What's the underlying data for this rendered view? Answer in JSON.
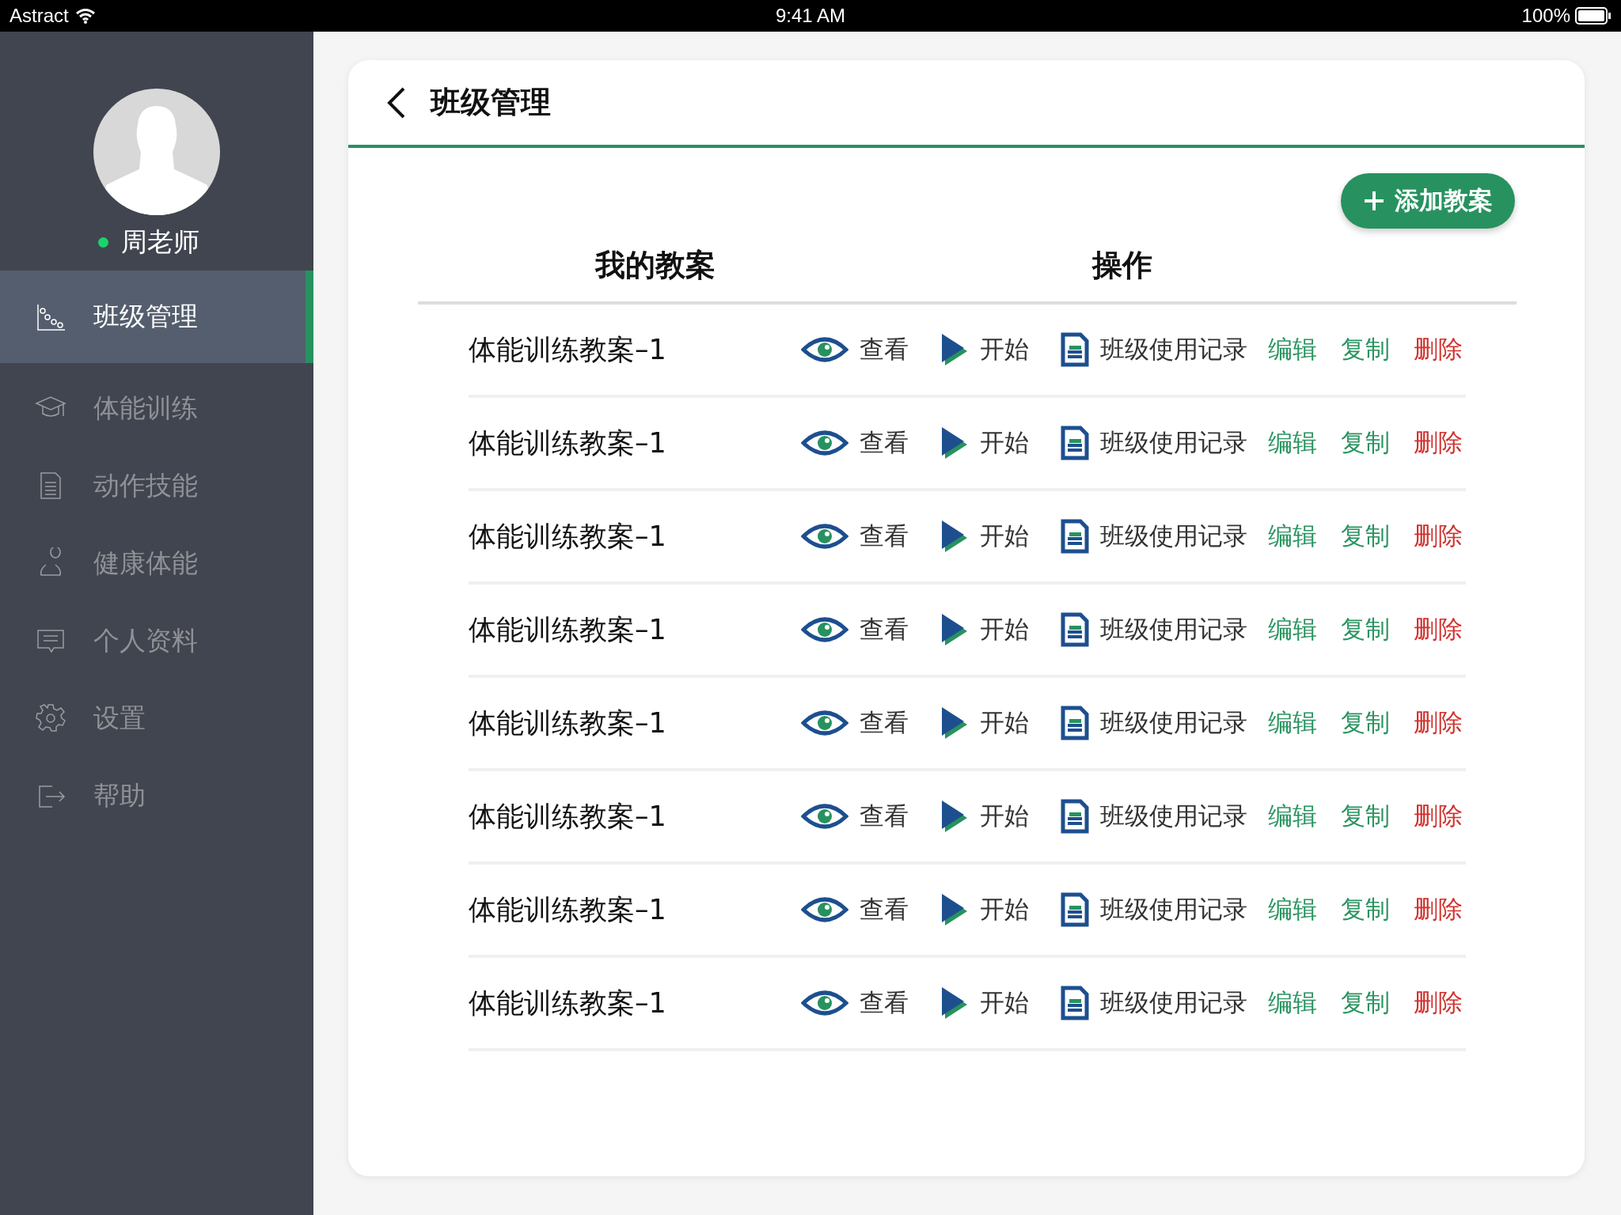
{
  "status_bar": {
    "carrier": "Astract",
    "time": "9:41 AM",
    "battery": "100%"
  },
  "sidebar": {
    "user": {
      "name": "周老师",
      "online": true
    },
    "items": [
      {
        "label": "班级管理",
        "kind": "chart",
        "selected": true
      },
      {
        "label": "体能训练",
        "kind": "cap",
        "selected": false
      },
      {
        "label": "动作技能",
        "kind": "doc",
        "selected": false
      },
      {
        "label": "健康体能",
        "kind": "person",
        "selected": false
      },
      {
        "label": "个人资料",
        "kind": "chat",
        "selected": false
      },
      {
        "label": "设置",
        "kind": "gear",
        "selected": false
      },
      {
        "label": "帮助",
        "kind": "exit",
        "selected": false
      }
    ]
  },
  "page": {
    "title": "班级管理",
    "add_button": "添加教案",
    "table": {
      "columns": [
        "我的教案",
        "操作"
      ],
      "rows": [
        {
          "name": "体能训练教案–1",
          "actions": [
            {
              "kind": "view",
              "label": "查看"
            },
            {
              "kind": "start",
              "label": "开始"
            },
            {
              "kind": "record",
              "label": "班级使用记录"
            },
            {
              "kind": "link",
              "label": "编辑",
              "color": "#2a9460"
            },
            {
              "kind": "link",
              "label": "复制",
              "color": "#2a9460"
            },
            {
              "kind": "link",
              "label": "删除",
              "color": "#d0312d"
            }
          ]
        },
        {
          "name": "体能训练教案–1",
          "actions": [
            {
              "kind": "view",
              "label": "查看"
            },
            {
              "kind": "start",
              "label": "开始"
            },
            {
              "kind": "record",
              "label": "班级使用记录"
            },
            {
              "kind": "link",
              "label": "编辑",
              "color": "#2a9460"
            },
            {
              "kind": "link",
              "label": "复制",
              "color": "#2a9460"
            },
            {
              "kind": "link",
              "label": "删除",
              "color": "#d0312d"
            }
          ]
        },
        {
          "name": "体能训练教案–1",
          "actions": [
            {
              "kind": "view",
              "label": "查看"
            },
            {
              "kind": "start",
              "label": "开始"
            },
            {
              "kind": "record",
              "label": "班级使用记录"
            },
            {
              "kind": "link",
              "label": "编辑",
              "color": "#2a9460"
            },
            {
              "kind": "link",
              "label": "复制",
              "color": "#2a9460"
            },
            {
              "kind": "link",
              "label": "删除",
              "color": "#d0312d"
            }
          ]
        },
        {
          "name": "体能训练教案–1",
          "actions": [
            {
              "kind": "view",
              "label": "查看"
            },
            {
              "kind": "start",
              "label": "开始"
            },
            {
              "kind": "record",
              "label": "班级使用记录"
            },
            {
              "kind": "link",
              "label": "编辑",
              "color": "#2a9460"
            },
            {
              "kind": "link",
              "label": "复制",
              "color": "#2a9460"
            },
            {
              "kind": "link",
              "label": "删除",
              "color": "#d0312d"
            }
          ]
        },
        {
          "name": "体能训练教案–1",
          "actions": [
            {
              "kind": "view",
              "label": "查看"
            },
            {
              "kind": "start",
              "label": "开始"
            },
            {
              "kind": "record",
              "label": "班级使用记录"
            },
            {
              "kind": "link",
              "label": "编辑",
              "color": "#2a9460"
            },
            {
              "kind": "link",
              "label": "复制",
              "color": "#2a9460"
            },
            {
              "kind": "link",
              "label": "删除",
              "color": "#d0312d"
            }
          ]
        },
        {
          "name": "体能训练教案–1",
          "actions": [
            {
              "kind": "view",
              "label": "查看"
            },
            {
              "kind": "start",
              "label": "开始"
            },
            {
              "kind": "record",
              "label": "班级使用记录"
            },
            {
              "kind": "link",
              "label": "编辑",
              "color": "#2a9460"
            },
            {
              "kind": "link",
              "label": "复制",
              "color": "#2a9460"
            },
            {
              "kind": "link",
              "label": "删除",
              "color": "#d0312d"
            }
          ]
        },
        {
          "name": "体能训练教案–1",
          "actions": [
            {
              "kind": "view",
              "label": "查看"
            },
            {
              "kind": "start",
              "label": "开始"
            },
            {
              "kind": "record",
              "label": "班级使用记录"
            },
            {
              "kind": "link",
              "label": "编辑",
              "color": "#2a9460"
            },
            {
              "kind": "link",
              "label": "复制",
              "color": "#2a9460"
            },
            {
              "kind": "link",
              "label": "删除",
              "color": "#d0312d"
            }
          ]
        },
        {
          "name": "体能训练教案–1",
          "actions": [
            {
              "kind": "view",
              "label": "查看"
            },
            {
              "kind": "start",
              "label": "开始"
            },
            {
              "kind": "record",
              "label": "班级使用记录"
            },
            {
              "kind": "link",
              "label": "编辑",
              "color": "#2a9460"
            },
            {
              "kind": "link",
              "label": "复制",
              "color": "#2a9460"
            },
            {
              "kind": "link",
              "label": "删除",
              "color": "#d0312d"
            }
          ]
        }
      ]
    }
  }
}
